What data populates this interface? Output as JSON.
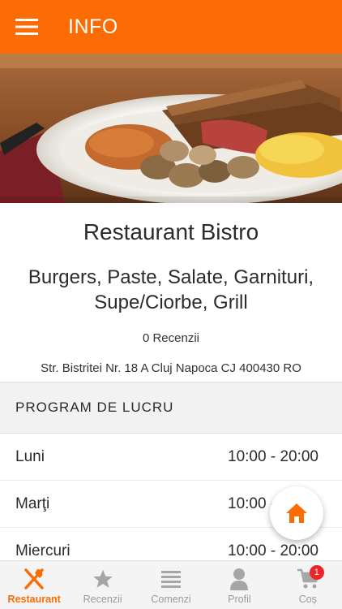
{
  "app_bar": {
    "title": "INFO",
    "menu_icon": "hamburger-menu-icon",
    "color": "#fb6c04"
  },
  "hero": {
    "image": "breakfast-plate-photo"
  },
  "restaurant": {
    "name": "Restaurant Bistro",
    "categories": "Burgers, Paste, Salate, Garnituri, Supe/Ciorbe, Grill",
    "reviews": "0 Recenzii",
    "address": "Str. Bistritei Nr. 18 A Cluj Napoca CJ 400430 RO"
  },
  "schedule": {
    "title": "PROGRAM DE LUCRU",
    "rows": [
      {
        "day": "Luni",
        "hours": "10:00 - 20:00"
      },
      {
        "day": "Marţi",
        "hours": "10:00 - 20:00"
      },
      {
        "day": "Miercuri",
        "hours": "10:00 - 20:00"
      }
    ]
  },
  "fab": {
    "icon": "home-icon"
  },
  "bottom_nav": {
    "items": [
      {
        "label": "Restaurant",
        "icon": "fork-knife-icon",
        "active": true
      },
      {
        "label": "Recenzii",
        "icon": "star-icon",
        "active": false
      },
      {
        "label": "Comenzi",
        "icon": "list-icon",
        "active": false
      },
      {
        "label": "Profil",
        "icon": "person-icon",
        "active": false
      },
      {
        "label": "Coș",
        "icon": "cart-icon",
        "active": false,
        "badge": "1"
      }
    ]
  }
}
